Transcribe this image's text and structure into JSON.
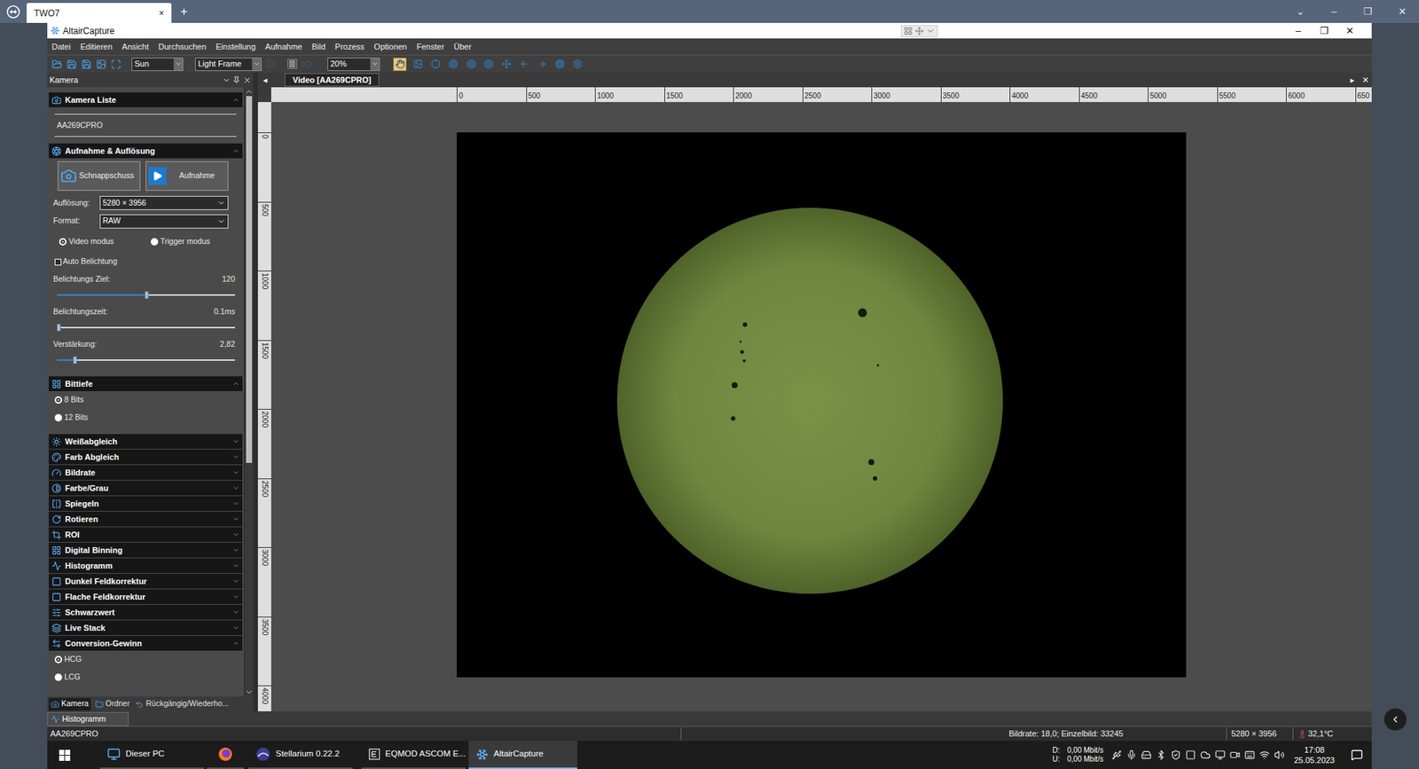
{
  "remote_tab_bar": {
    "tab": "TWO7",
    "tab_close": "×",
    "new_tab": "+",
    "controls": [
      "⌄",
      "–",
      "❐",
      "✕"
    ]
  },
  "window": {
    "title": "AltairCapture",
    "controls": [
      "–",
      "❐",
      "✕"
    ]
  },
  "menu": [
    "Datei",
    "Editieren",
    "Ansicht",
    "Durchsuchen",
    "Einstellung",
    "Aufnahme",
    "Bild",
    "Prozess",
    "Optionen",
    "Fenster",
    "Über"
  ],
  "toolbar": {
    "combos": [
      "Sun",
      "Light Frame",
      "20%"
    ],
    "tools": [
      {
        "selected": true
      },
      {
        "selected": false
      },
      {
        "selected": false
      },
      {
        "selected": false
      },
      {
        "selected": false
      },
      {
        "selected": false
      },
      {
        "selected": false
      },
      {
        "selected": false
      },
      {
        "selected": false
      },
      {
        "selected": false
      },
      {
        "selected": false
      }
    ]
  },
  "camera_panel": {
    "title": "Kamera",
    "scrollbar": {
      "level": 0.62
    },
    "camera_list": {
      "title": "Kamera Liste",
      "expanded": true,
      "cameras": [
        "AA269CPRO"
      ]
    },
    "capture": {
      "title": "Aufnahme & Auflösung",
      "expanded": true,
      "buttons": [
        "Schnappschuss",
        "Aufnahme"
      ],
      "resolution": {
        "label": "Auflösung:",
        "value": "5280 × 3956"
      },
      "format": {
        "label": "Format:",
        "value": "RAW"
      },
      "modes": [
        {
          "label": "Video modus",
          "selected": true
        },
        {
          "label": "Trigger modus",
          "selected": false
        }
      ],
      "auto_exposure": {
        "label": "Auto Belichtung",
        "checked": false
      },
      "sliders": [
        {
          "label": "Belichtungs Ziel:",
          "reading": "120",
          "level": 0.5
        },
        {
          "label": "Belichtungszeit:",
          "reading": "0.1ms",
          "level": 0.01
        },
        {
          "label": "Verstärkung:",
          "reading": "2,82",
          "level": 0.1
        }
      ]
    },
    "bit_depth": {
      "title": "Bittiefe",
      "expanded": true,
      "options": [
        {
          "label": "8 Bits",
          "selected": true
        },
        {
          "label": "12 Bits",
          "selected": false
        }
      ]
    },
    "collapsed_sections": [
      {
        "title": "Weißabgleich",
        "expanded": false
      },
      {
        "title": "Farb Abgleich",
        "expanded": false
      },
      {
        "title": "Bildrate",
        "expanded": false
      },
      {
        "title": "Farbe/Grau",
        "expanded": false
      },
      {
        "title": "Spiegeln",
        "expanded": false
      },
      {
        "title": "Rotieren",
        "expanded": false
      },
      {
        "title": "ROI",
        "expanded": false
      },
      {
        "title": "Digital Binning",
        "expanded": false
      },
      {
        "title": "Histogramm",
        "expanded": false
      },
      {
        "title": "Dunkel Feldkorrektur",
        "expanded": false
      },
      {
        "title": "Flache Feldkorrektur",
        "expanded": false
      },
      {
        "title": "Schwarzwert",
        "expanded": false
      },
      {
        "title": "Live Stack",
        "expanded": false
      }
    ],
    "conversion_gain": {
      "title": "Conversion-Gewinn",
      "expanded": true,
      "options": [
        {
          "label": "HCG",
          "selected": true
        },
        {
          "label": "LCG",
          "selected": false
        }
      ]
    },
    "tabs": [
      {
        "label": "Kamera",
        "selected": true
      },
      {
        "label": "Ordner",
        "selected": false
      },
      {
        "label": "Rückgängig/Wiederho...",
        "selected": false
      }
    ]
  },
  "video": {
    "nav_left": "◂",
    "nav_right": "▸",
    "close": "✕",
    "tab": {
      "label": "Video [AA269CPRO]",
      "selected": true
    },
    "ruler_x": [
      "0",
      "500",
      "1000",
      "1500",
      "2000",
      "2500",
      "3000",
      "3500",
      "4000",
      "4500",
      "5000",
      "5500",
      "6000",
      "650"
    ],
    "ruler_y": [
      "0",
      "500",
      "1000",
      "1500",
      "2000",
      "2500",
      "3000",
      "3500",
      "4000"
    ]
  },
  "bottom_tab": {
    "label": "Histogramm",
    "selected": true
  },
  "status_bar": {
    "camera": "AA269CPRO",
    "framerate": "Bildrate: 18,0; Einzelbild: 33245",
    "resolution": "5280 × 3956",
    "temperature": "32,1°C"
  },
  "taskbar": {
    "apps": [
      {
        "label": "Dieser PC",
        "selected": false
      },
      {
        "label": "",
        "selected": false
      },
      {
        "label": "Stellarium 0.22.2",
        "selected": false
      },
      {
        "label": "EQMOD ASCOM E...",
        "selected": false
      },
      {
        "label": "AltairCapture",
        "selected": true
      }
    ],
    "network": {
      "labels": [
        "D:",
        "U:"
      ],
      "rates": [
        "0,00 Mbit/s",
        "0,00 Mbit/s"
      ]
    },
    "clock": {
      "time": "17:08",
      "date": "25.05.2023"
    }
  }
}
